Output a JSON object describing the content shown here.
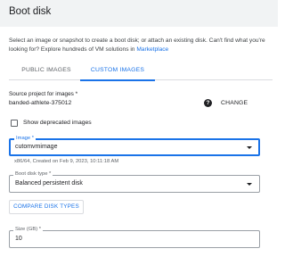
{
  "dialog": {
    "title": "Boot disk"
  },
  "description": {
    "text": "Select an image or snapshot to create a boot disk; or attach an existing disk. Can't find what you're looking for? Explore hundreds of VM solutions in ",
    "link": "Marketplace"
  },
  "tabs": [
    {
      "label": "PUBLIC IMAGES",
      "active": false
    },
    {
      "label": "CUSTOM IMAGES",
      "active": true
    }
  ],
  "source_project": {
    "label": "Source project for images *",
    "value": "banded-athlete-375012",
    "help_icon": "?",
    "change_label": "CHANGE"
  },
  "deprecated": {
    "label": "Show deprecated images",
    "checked": false
  },
  "image": {
    "label": "Image *",
    "value": "cutomvmimage",
    "hint": "x86/64, Created on Feb 9, 2023, 10:11:18 AM"
  },
  "boot_disk_type": {
    "label": "Boot disk type *",
    "value": "Balanced persistent disk"
  },
  "compare_button": {
    "label": "COMPARE DISK TYPES"
  },
  "size": {
    "label": "Size (GB) *",
    "value": "10"
  },
  "colors": {
    "accent": "#1a73e8",
    "header_bg": "#f1f3f4",
    "text": "#202124",
    "muted": "#5f6368"
  }
}
